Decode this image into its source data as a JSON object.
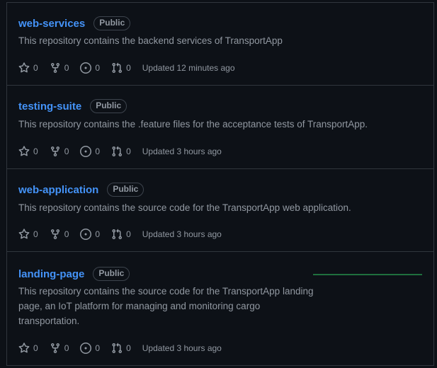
{
  "repos": [
    {
      "name": "web-services",
      "visibility": "Public",
      "description": "This repository contains the backend services of TransportApp",
      "stars": "0",
      "forks": "0",
      "issues": "0",
      "pull_requests": "0",
      "updated": "Updated 12 minutes ago"
    },
    {
      "name": "testing-suite",
      "visibility": "Public",
      "description": "This repository contains the .feature files for the acceptance tests of TransportApp.",
      "stars": "0",
      "forks": "0",
      "issues": "0",
      "pull_requests": "0",
      "updated": "Updated 3 hours ago"
    },
    {
      "name": "web-application",
      "visibility": "Public",
      "description": "This repository contains the source code for the TransportApp web application.",
      "stars": "0",
      "forks": "0",
      "issues": "0",
      "pull_requests": "0",
      "updated": "Updated 3 hours ago"
    },
    {
      "name": "landing-page",
      "visibility": "Public",
      "description": "This repository contains the source code for the TransportApp landing page, an IoT platform for managing and monitoring cargo transportation.",
      "stars": "0",
      "forks": "0",
      "issues": "0",
      "pull_requests": "0",
      "updated": "Updated 3 hours ago"
    }
  ],
  "icons": {
    "star": "star-icon",
    "fork": "fork-icon",
    "issue": "issue-opened-icon",
    "pull_request": "pull-request-icon"
  },
  "colors": {
    "background": "#0d1117",
    "link": "#4493f8",
    "muted": "#9198a1",
    "border": "#30363d",
    "activity": "#1f6f3e"
  }
}
